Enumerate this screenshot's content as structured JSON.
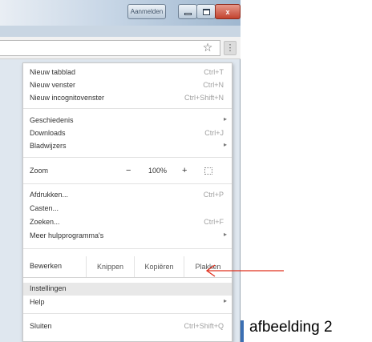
{
  "titlebar": {
    "signin_label": "Aanmelden",
    "close_label": "x"
  },
  "toolbar": {
    "star_glyph": "☆",
    "menu_glyph": "⋮"
  },
  "menu": {
    "new_tab": {
      "label": "Nieuw tabblad",
      "shortcut": "Ctrl+T"
    },
    "new_window": {
      "label": "Nieuw venster",
      "shortcut": "Ctrl+N"
    },
    "new_incognito": {
      "label": "Nieuw incognitovenster",
      "shortcut": "Ctrl+Shift+N"
    },
    "history": {
      "label": "Geschiedenis"
    },
    "downloads": {
      "label": "Downloads",
      "shortcut": "Ctrl+J"
    },
    "bookmarks": {
      "label": "Bladwijzers"
    },
    "zoom": {
      "label": "Zoom",
      "minus": "−",
      "value": "100%",
      "plus": "+"
    },
    "print": {
      "label": "Afdrukken...",
      "shortcut": "Ctrl+P"
    },
    "cast": {
      "label": "Casten..."
    },
    "find": {
      "label": "Zoeken...",
      "shortcut": "Ctrl+F"
    },
    "more_tools": {
      "label": "Meer hulpprogramma's"
    },
    "edit": {
      "label": "Bewerken",
      "cut": "Knippen",
      "copy": "Kopiëren",
      "paste": "Plakken"
    },
    "settings": {
      "label": "Instellingen"
    },
    "help": {
      "label": "Help"
    },
    "exit": {
      "label": "Sluiten",
      "shortcut": "Ctrl+Shift+Q"
    },
    "submenu_arrow": "▸"
  },
  "annotation": {
    "caption": "afbeelding 2",
    "arrow_color": "#e0301e"
  }
}
